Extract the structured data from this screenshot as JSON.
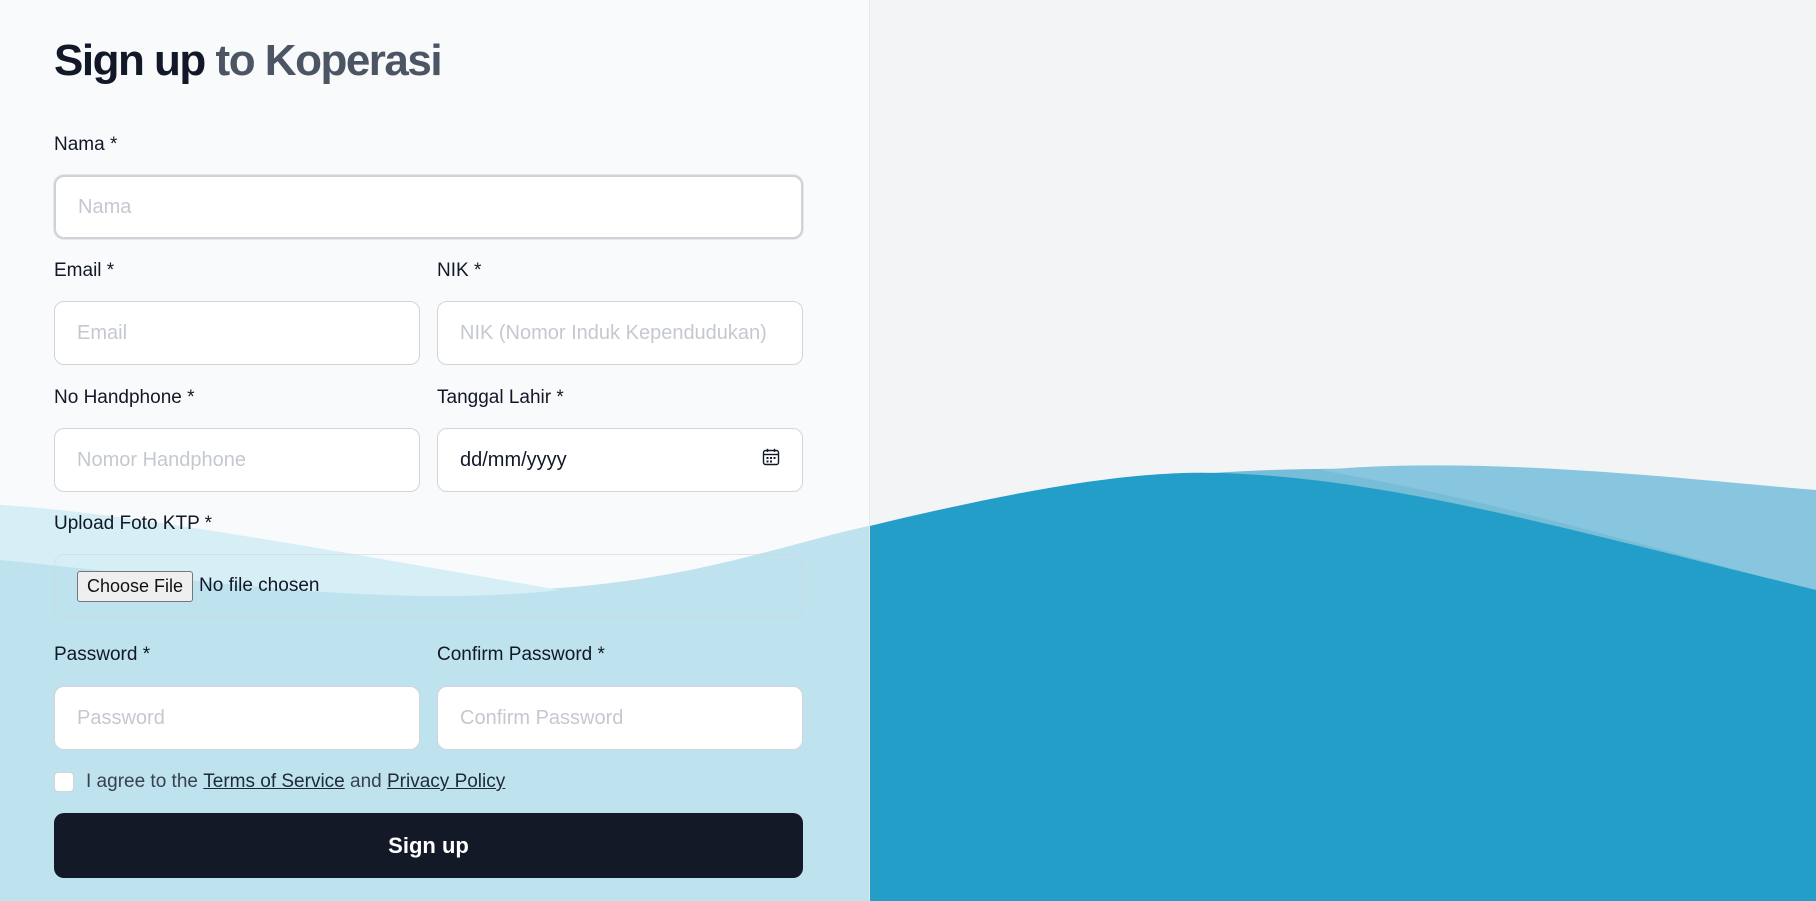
{
  "page": {
    "title_main": "Sign up",
    "title_accent": " to Koperasi"
  },
  "fields": {
    "nama": {
      "label": "Nama *",
      "placeholder": "Nama",
      "value": ""
    },
    "email": {
      "label": "Email *",
      "placeholder": "Email",
      "value": ""
    },
    "nik": {
      "label": "NIK *",
      "placeholder": "NIK (Nomor Induk Kependudukan)",
      "value": ""
    },
    "phone": {
      "label": "No Handphone *",
      "placeholder": "Nomor Handphone",
      "value": ""
    },
    "birthdate": {
      "label": "Tanggal Lahir *",
      "display": "dd/mm/yyyy"
    },
    "ktp": {
      "label": "Upload Foto KTP *",
      "button": "Choose File",
      "status": "No file chosen"
    },
    "password": {
      "label": "Password *",
      "placeholder": "Password",
      "value": ""
    },
    "confirm_password": {
      "label": "Confirm Password *",
      "placeholder": "Confirm Password",
      "value": ""
    }
  },
  "agreement": {
    "prefix": "I agree to the ",
    "terms": "Terms of Service",
    "middle": " and ",
    "privacy": "Privacy Policy",
    "checked": false
  },
  "submit_label": "Sign up",
  "icons": {
    "date_picker": "calendar-icon"
  },
  "colors": {
    "wave_primary": "#229ec8",
    "submit_bg": "#131927",
    "page_bg": "#f3f4f6"
  }
}
